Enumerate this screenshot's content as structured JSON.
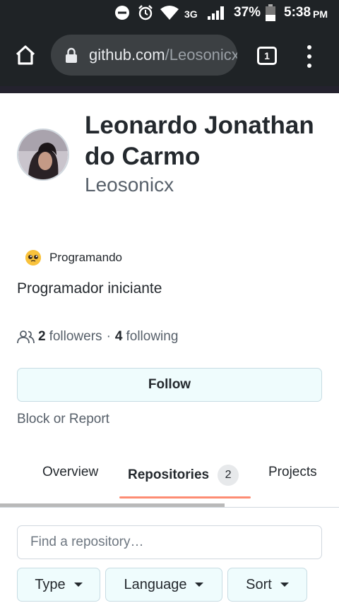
{
  "status_bar": {
    "network": "3G",
    "battery": "37%",
    "time": "5:38",
    "ampm": "PM"
  },
  "browser": {
    "url_host": "github.com",
    "url_path": "/Leosonicx",
    "tab_count": "1"
  },
  "profile": {
    "full_name": "Leonardo Jonathan do Carmo",
    "username": "Leosonicx",
    "status": "Programando",
    "bio": "Programador iniciante",
    "followers_count": "2",
    "followers_label": "followers",
    "separator": "·",
    "following_count": "4",
    "following_label": "following",
    "follow_label": "Follow",
    "block_label": "Block or Report"
  },
  "tabs": [
    {
      "label": "Overview"
    },
    {
      "label": "Repositories",
      "count": "2"
    },
    {
      "label": "Projects"
    }
  ],
  "repo_filters": {
    "search_placeholder": "Find a repository…",
    "type_label": "Type",
    "language_label": "Language",
    "sort_label": "Sort"
  },
  "colors": {
    "browser_chrome": "#1f2326",
    "tab_underline": "#fd8c73",
    "button_bg": "#effcfd"
  }
}
